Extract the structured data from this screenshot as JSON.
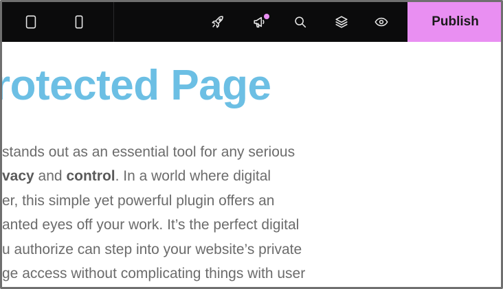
{
  "toolbar": {
    "icons": {
      "desktop": "tablet-icon",
      "mobile": "mobile-icon",
      "launch": "rocket-icon",
      "announce": "megaphone-icon",
      "search": "search-icon",
      "layers": "layers-icon",
      "preview": "eye-icon"
    },
    "publish_label": "Publish"
  },
  "colors": {
    "toolbar_bg": "#0b0b0c",
    "publish_bg": "#e98ff2",
    "notification_dot": "#e98ff2",
    "title": "#6cbfe4",
    "body_text": "#6b6b6b"
  },
  "content": {
    "title": "rotected Page",
    "lines": [
      [
        {
          "t": " stands out as an essential tool for any serious",
          "b": false
        }
      ],
      [
        {
          "t": "vacy",
          "b": true
        },
        {
          "t": " and ",
          "b": false
        },
        {
          "t": "control",
          "b": true
        },
        {
          "t": ". In a world where digital",
          "b": false
        }
      ],
      [
        {
          "t": "er, this simple yet powerful plugin offers an",
          "b": false
        }
      ],
      [
        {
          "t": "anted eyes off your work. It’s the perfect digital",
          "b": false
        }
      ],
      [
        {
          "t": "u authorize can step into your website’s private",
          "b": false
        }
      ],
      [
        {
          "t": "ge access without complicating things with user",
          "b": false
        }
      ]
    ]
  }
}
